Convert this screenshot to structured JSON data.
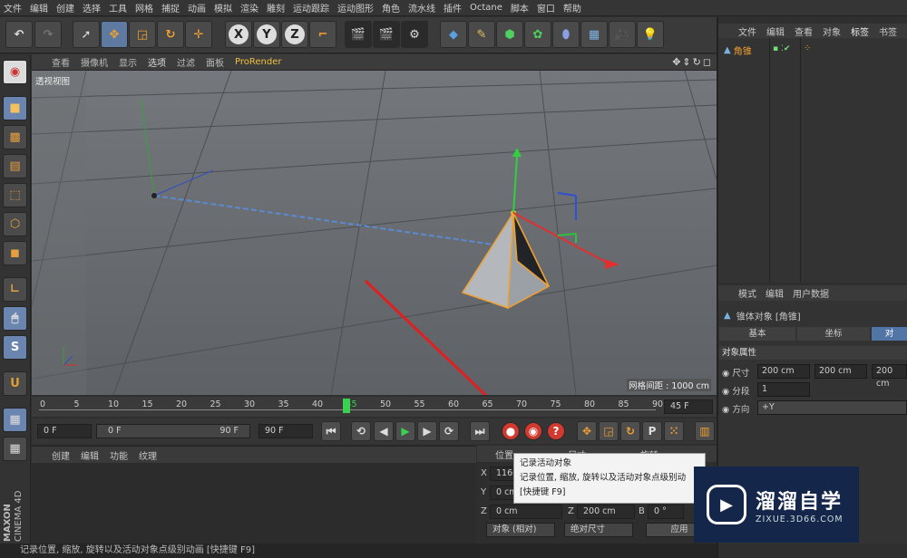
{
  "menu": [
    "文件",
    "编辑",
    "创建",
    "选择",
    "工具",
    "网格",
    "捕捉",
    "动画",
    "模拟",
    "渲染",
    "雕刻",
    "运动跟踪",
    "运动图形",
    "角色",
    "流水线",
    "插件",
    "Octane",
    "脚本",
    "窗口",
    "帮助"
  ],
  "viewport": {
    "menu": [
      "查看",
      "摄像机",
      "显示",
      "选项",
      "过滤",
      "面板",
      "ProRender"
    ],
    "label": "透视视图",
    "grid_spacing": "网格间距 : 1000 cm"
  },
  "timeline": {
    "ticks": [
      "0",
      "5",
      "10",
      "15",
      "20",
      "25",
      "30",
      "35",
      "40",
      "45",
      "50",
      "55",
      "60",
      "65",
      "70",
      "75",
      "80",
      "85",
      "90"
    ],
    "current_frame": "45",
    "frame_display": "45 F",
    "start_frame": "0 F",
    "range_start": "0 F",
    "range_end": "90 F",
    "end_frame": "90 F"
  },
  "material_panel": {
    "menu": [
      "创建",
      "编辑",
      "功能",
      "纹理"
    ]
  },
  "coords": {
    "headers": [
      "位置",
      "尺寸",
      "旋转"
    ],
    "x_value": "1166.",
    "y_value": "0 cm",
    "z_value": "0 cm",
    "z_size": "200 cm",
    "b_value": "0 °",
    "mode_object": "对象 (相对)",
    "mode_size": "绝对尺寸",
    "apply": "应用"
  },
  "object_manager": {
    "menu": [
      "文件",
      "编辑",
      "查看",
      "对象",
      "标签",
      "书签"
    ],
    "item": "角锥"
  },
  "attributes": {
    "menu": [
      "模式",
      "编辑",
      "用户数据"
    ],
    "title": "锥体对象 [角锥]",
    "tabs": [
      "基本",
      "坐标",
      "对"
    ],
    "section": "对象属性",
    "size_label": "尺寸",
    "size_values": [
      "200 cm",
      "200 cm",
      "200 cm"
    ],
    "segments_label": "分段",
    "segments_value": "1",
    "orientation_label": "方向",
    "orientation_value": "+Y"
  },
  "tooltip": {
    "title": "记录活动对象",
    "body": "记录位置, 缩放, 旋转以及活动对象点级别动",
    "shortcut": "[快捷键 F9]"
  },
  "status": "记录位置, 缩放, 旋转以及活动对象点级别动画 [快捷键 F9]",
  "brand": {
    "maxon": "MAXON",
    "cinema": "CINEMA 4D"
  },
  "watermark": {
    "name": "溜溜自学",
    "url": "ZIXUE.3D66.COM"
  },
  "colors": {
    "accent": "#5275a8",
    "record": "#d23a30",
    "arrow": "#e02020",
    "selection": "#f0a030"
  }
}
